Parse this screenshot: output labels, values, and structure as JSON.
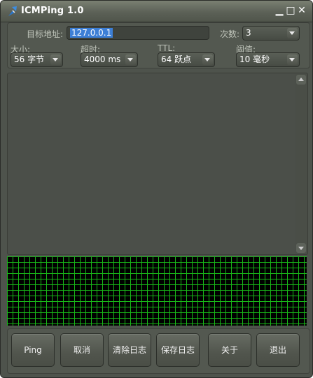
{
  "window": {
    "title": "ICMPing 1.0"
  },
  "controls": {
    "minimize": "▁",
    "maximize": "□",
    "close": "✕"
  },
  "form": {
    "target_label": "目标地址:",
    "target_value": "127.0.0.1",
    "count_label": "次数:",
    "count_value": "3",
    "size_label": "大小:",
    "size_value": "56 字节",
    "timeout_label": "超时:",
    "timeout_value": "4000 ms",
    "ttl_label": "TTL:",
    "ttl_value": "64 跃点",
    "threshold_label": "阈值:",
    "threshold_value": "10 毫秒"
  },
  "buttons": {
    "ping": "Ping",
    "cancel": "取消",
    "clear_log": "清除日志",
    "save_log": "保存日志",
    "about": "关于",
    "exit": "退出"
  },
  "colors": {
    "grid_line": "#18b818",
    "graph_background": "#000000",
    "selection": "#3d7fd6"
  },
  "icons": {
    "app": "icmping-app-icon",
    "dropdown": "chevron-down-icon"
  }
}
